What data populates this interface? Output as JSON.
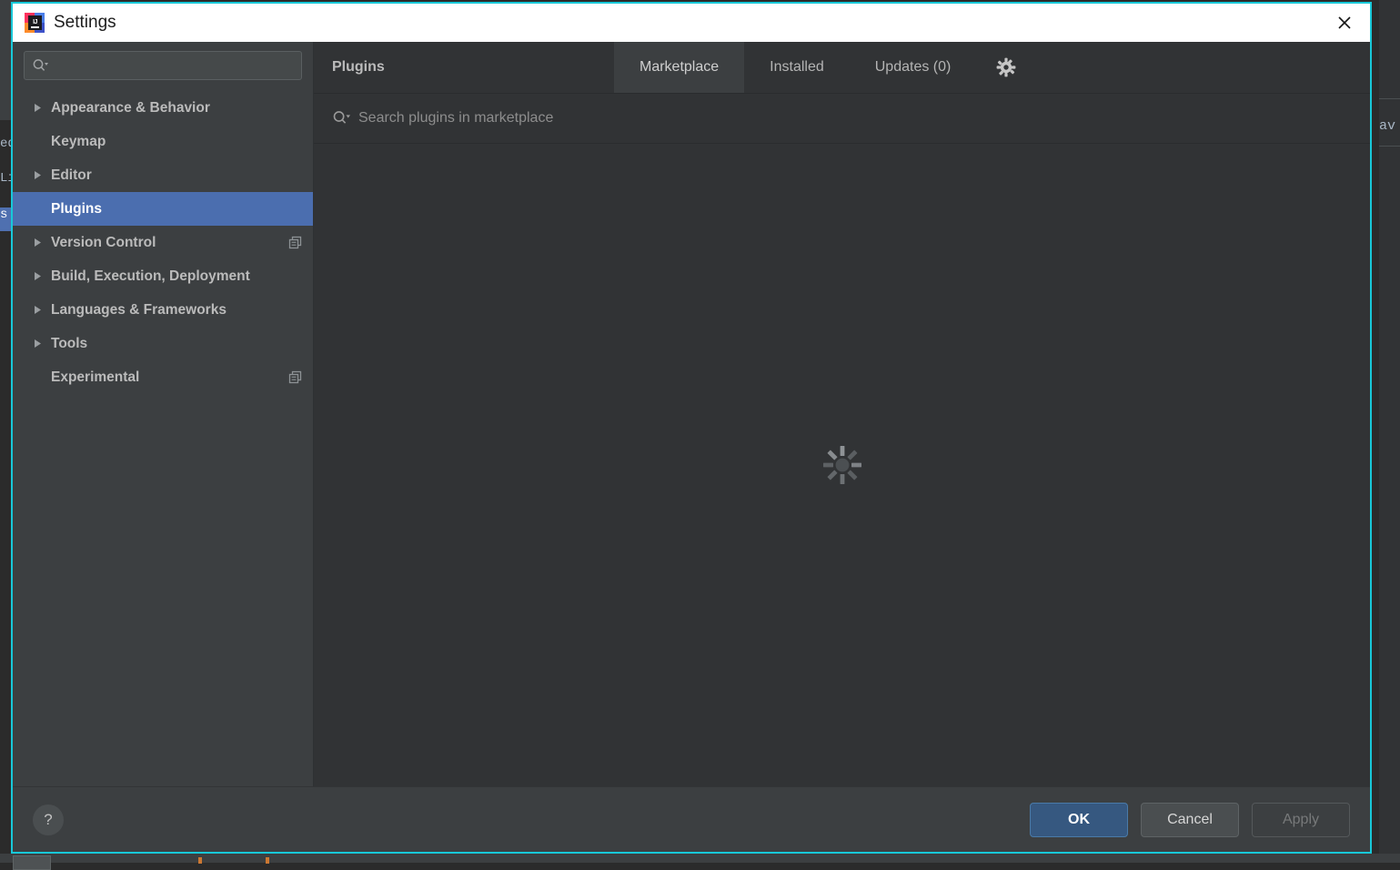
{
  "window": {
    "title": "Settings",
    "logo_icon": "intellij-idea-logo",
    "close_icon": "close-icon",
    "accent_border_color": "#18c8d8"
  },
  "sidebar": {
    "search": {
      "value": "",
      "placeholder": "",
      "icon": "search-icon"
    },
    "items": [
      {
        "label": "Appearance & Behavior",
        "expandable": true,
        "selected": false,
        "badge": null
      },
      {
        "label": "Keymap",
        "expandable": false,
        "selected": false,
        "badge": null
      },
      {
        "label": "Editor",
        "expandable": true,
        "selected": false,
        "badge": null
      },
      {
        "label": "Plugins",
        "expandable": false,
        "selected": true,
        "badge": null
      },
      {
        "label": "Version Control",
        "expandable": true,
        "selected": false,
        "badge": "copy-icon"
      },
      {
        "label": "Build, Execution, Deployment",
        "expandable": true,
        "selected": false,
        "badge": null
      },
      {
        "label": "Languages & Frameworks",
        "expandable": true,
        "selected": false,
        "badge": null
      },
      {
        "label": "Tools",
        "expandable": true,
        "selected": false,
        "badge": null
      },
      {
        "label": "Experimental",
        "expandable": false,
        "selected": false,
        "badge": "copy-icon"
      }
    ]
  },
  "content": {
    "panel_title": "Plugins",
    "tabs": [
      {
        "label": "Marketplace",
        "active": true
      },
      {
        "label": "Installed",
        "active": false
      },
      {
        "label": "Updates (0)",
        "active": false
      }
    ],
    "settings_gear_icon": "gear-icon",
    "search": {
      "value": "",
      "placeholder": "Search plugins in marketplace",
      "icon": "search-icon"
    },
    "loading": {
      "visible": true,
      "icon": "loading-spinner-icon"
    }
  },
  "footer": {
    "help_label": "?",
    "buttons": [
      {
        "label": "OK",
        "style": "primary",
        "enabled": true
      },
      {
        "label": "Cancel",
        "style": "default",
        "enabled": true
      },
      {
        "label": "Apply",
        "style": "disabled",
        "enabled": false
      }
    ]
  },
  "backdrop": {
    "left_text_lines": [
      "ed",
      "Li",
      "s a"
    ],
    "right_text": "av"
  }
}
